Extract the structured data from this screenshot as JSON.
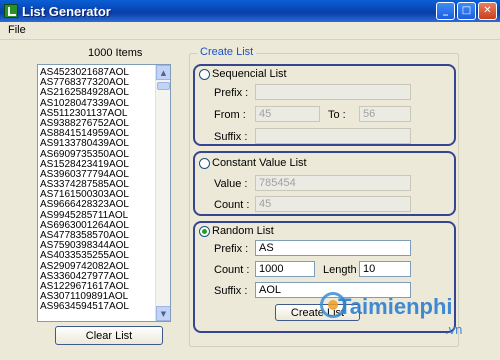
{
  "window": {
    "title": "List Generator"
  },
  "menu": {
    "file": "File"
  },
  "list": {
    "count_label": "1000 Items",
    "items": [
      "AS4523021687AOL",
      "AS7768377320AOL",
      "AS2162584928AOL",
      "AS1028047339AOL",
      "AS5112301137AOL",
      "AS9388276752AOL",
      "AS8841514959AOL",
      "AS9133780439AOL",
      "AS6909735350AOL",
      "AS1528423419AOL",
      "AS3960377794AOL",
      "AS3374287585AOL",
      "AS7161500303AOL",
      "AS9666428323AOL",
      "AS9945285711AOL",
      "AS6963001264AOL",
      "AS4778358570AOL",
      "AS7590398344AOL",
      "AS4033535255AOL",
      "AS2909742082AOL",
      "AS3360427977AOL",
      "AS1229671617AOL",
      "AS3071109891AOL",
      "AS9634594517AOL"
    ],
    "clear_button": "Clear List"
  },
  "create": {
    "group_label": "Create List",
    "sequential": {
      "label": "Sequencial List",
      "prefix_label": "Prefix :",
      "from_label": "From :",
      "from_value": "45",
      "to_label": "To :",
      "to_value": "56",
      "suffix_label": "Suffix :"
    },
    "constant": {
      "label": "Constant Value List",
      "value_label": "Value :",
      "value": "785454",
      "count_label": "Count :",
      "count": "45"
    },
    "random": {
      "label": "Random List",
      "prefix_label": "Prefix :",
      "prefix": "AS",
      "count_label": "Count :",
      "count": "1000",
      "length_label": "Length :",
      "length": "10",
      "suffix_label": "Suffix :",
      "suffix": "AOL"
    },
    "button": "Create List"
  },
  "icons": {
    "minimize": "minimize-icon",
    "maximize": "maximize-icon",
    "close": "close-icon"
  },
  "watermark": {
    "brand": "Taimienphi",
    "domain": ".vn"
  }
}
